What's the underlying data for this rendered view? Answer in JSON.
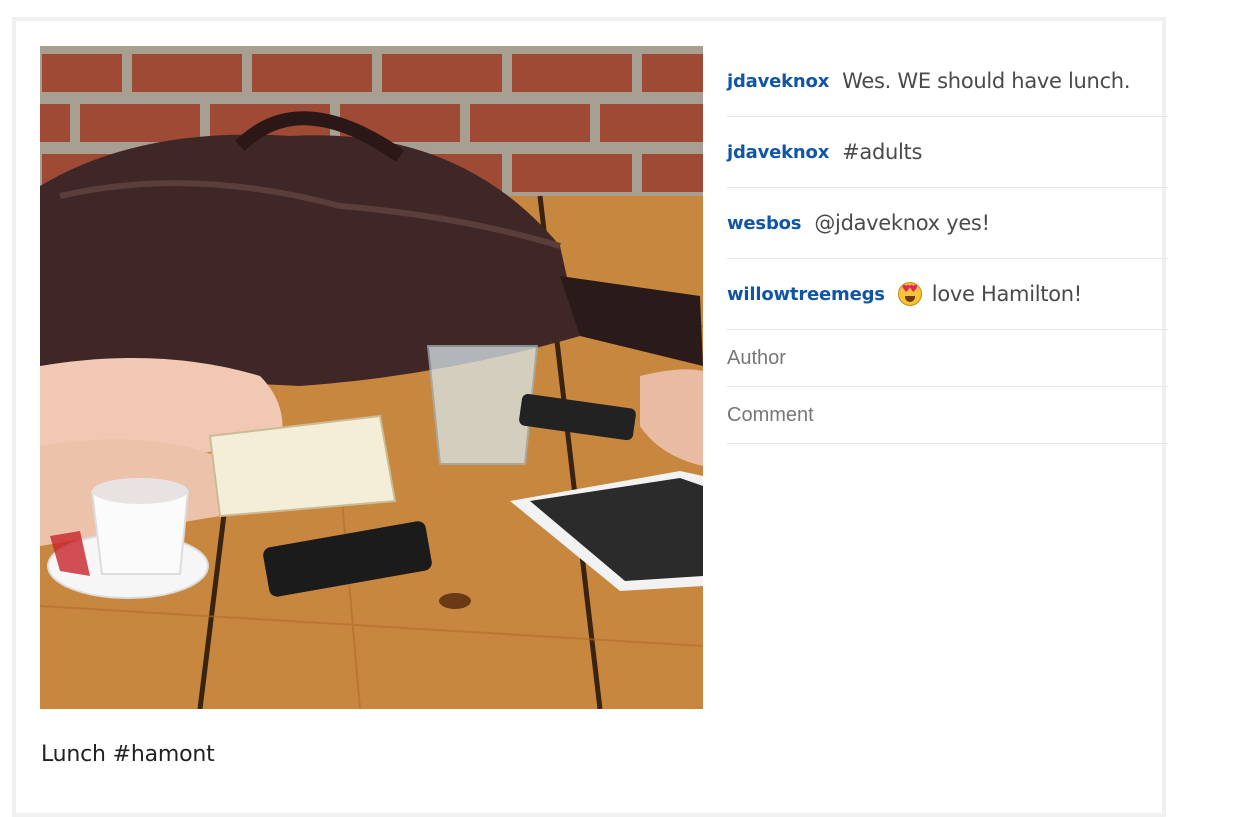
{
  "post": {
    "caption": "Lunch #hamont",
    "image_alt": "people working at cafe table"
  },
  "comments": [
    {
      "author": "jdaveknox",
      "text": "Wes. WE should have lunch."
    },
    {
      "author": "jdaveknox",
      "text": "#adults"
    },
    {
      "author": "wesbos",
      "text": "@jdaveknox yes!"
    },
    {
      "author": "willowtreemegs",
      "text": "love Hamilton!",
      "emoji": "heart-eyes-emoji-icon"
    }
  ],
  "form": {
    "author_placeholder": "Author",
    "comment_placeholder": "Comment"
  },
  "colors": {
    "author_link": "#1156a6",
    "text": "#4a4a4a",
    "divider": "#e6e6e6"
  }
}
